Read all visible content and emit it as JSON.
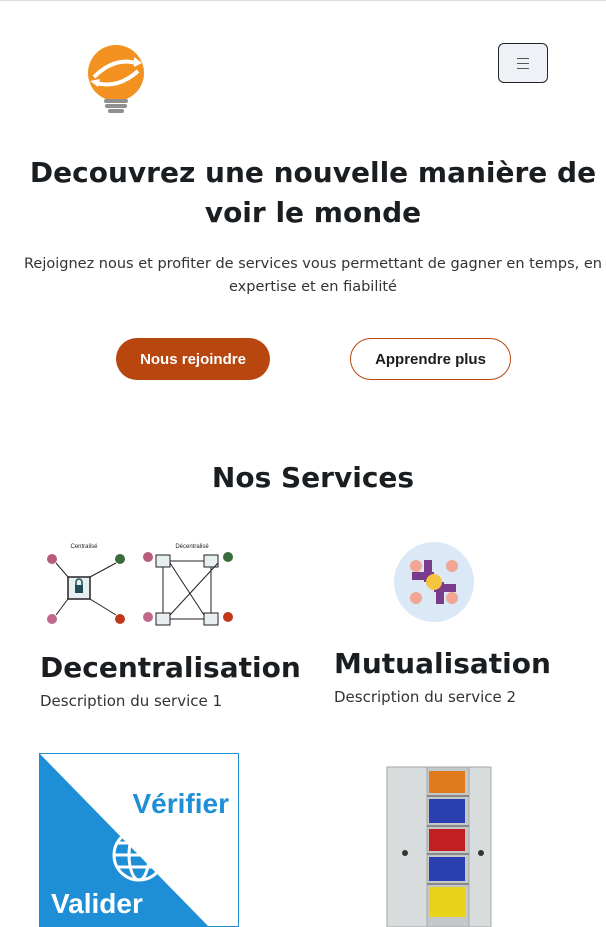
{
  "header": {
    "logo_icon": "lightbulb-globe-logo-icon",
    "menu_icon": "hamburger-menu-icon"
  },
  "hero": {
    "title": "Decouvrez une nouvelle manière de voir le monde",
    "subtitle": "Rejoignez nous et profiter de services vous permettant de gagner en temps, en expertise et en fiabilité",
    "primary_button": "Nous rejoindre",
    "secondary_button": "Apprendre plus"
  },
  "services": {
    "heading": "Nos Services",
    "items": [
      {
        "title": "Decentralisation",
        "description": "Description du service 1",
        "image_labels": {
          "left": "Centralisé",
          "right": "Décentralisé"
        }
      },
      {
        "title": "Mutualisation",
        "description": "Description du service 2"
      },
      {
        "image_labels": {
          "top": "Vérifier",
          "bottom": "Valider"
        }
      },
      {
        "image_icon": "filing-cabinet-icon"
      }
    ]
  },
  "colors": {
    "accent": "#b8460f",
    "logo_orange": "#f39221",
    "text_dark": "#1b1e21",
    "validate_blue": "#1e8fd6"
  }
}
